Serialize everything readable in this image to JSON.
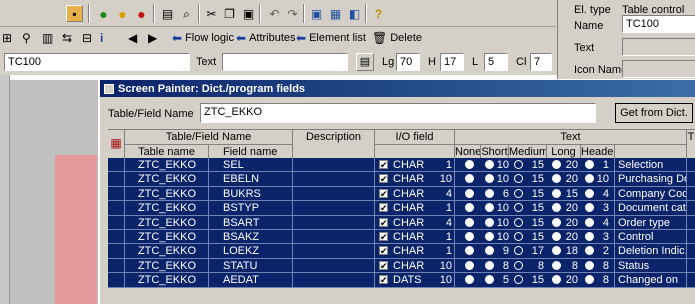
{
  "toolbar1": {
    "icons": [
      "save-icon",
      "back-icon",
      "exit-icon",
      "cancel-icon",
      "print-icon",
      "find-icon",
      "find-next-icon",
      "cut-icon",
      "copy-icon",
      "paste-icon",
      "undo-icon",
      "redo-icon",
      "layout-icon",
      "graphic-icon",
      "window-icon",
      "help-icon"
    ]
  },
  "toolbar2": {
    "flow_logic": "Flow logic",
    "attributes": "Attributes",
    "element_list": "Element list",
    "delete": "Delete"
  },
  "fields": {
    "name_value": "TC100",
    "text_label": "Text",
    "lg_label": "Lg",
    "lg_value": "70",
    "h_label": "H",
    "h_value": "17",
    "l_label": "L",
    "l_value": "5",
    "cl_label": "Cl",
    "cl_value": "7"
  },
  "right_panel": {
    "el_type_label": "El. type",
    "el_type_value": "Table control",
    "name_label": "Name",
    "name_value": "TC100",
    "text_label": "Text",
    "icon_name_label": "Icon Name"
  },
  "dialog": {
    "title": "Screen Painter: Dict./program fields",
    "table_field_label": "Table/Field Name",
    "table_field_value": "ZTC_EKKO",
    "get_from_dict": "Get from Dict.",
    "headers": {
      "table_field_name": "Table/Field Name",
      "table_name": "Table name",
      "field_name": "Field name",
      "description": "Description",
      "io_field": "I/O field",
      "text": "Text",
      "none": "None",
      "short": "Short",
      "medium": "Medium",
      "long": "Long",
      "header": "Header",
      "t": "T"
    },
    "rows": [
      {
        "table": "ZTC_EKKO",
        "field": "SEL",
        "type": "CHAR",
        "len": "1",
        "short": "10",
        "medium": "15",
        "long": "20",
        "header": "1",
        "text": "Selection",
        "sel": "medium"
      },
      {
        "table": "ZTC_EKKO",
        "field": "EBELN",
        "type": "CHAR",
        "len": "10",
        "short": "10",
        "medium": "15",
        "long": "20",
        "header": "10",
        "text": "Purchasing Doc.",
        "sel": "medium"
      },
      {
        "table": "ZTC_EKKO",
        "field": "BUKRS",
        "type": "CHAR",
        "len": "4",
        "short": "6",
        "medium": "15",
        "long": "15",
        "header": "4",
        "text": "Company Code",
        "sel": "medium"
      },
      {
        "table": "ZTC_EKKO",
        "field": "BSTYP",
        "type": "CHAR",
        "len": "1",
        "short": "10",
        "medium": "15",
        "long": "20",
        "header": "3",
        "text": "Document cat.",
        "sel": "medium"
      },
      {
        "table": "ZTC_EKKO",
        "field": "BSART",
        "type": "CHAR",
        "len": "4",
        "short": "10",
        "medium": "15",
        "long": "20",
        "header": "4",
        "text": "Order type",
        "sel": "medium"
      },
      {
        "table": "ZTC_EKKO",
        "field": "BSAKZ",
        "type": "CHAR",
        "len": "1",
        "short": "10",
        "medium": "15",
        "long": "20",
        "header": "3",
        "text": "Control",
        "sel": "medium"
      },
      {
        "table": "ZTC_EKKO",
        "field": "LOEKZ",
        "type": "CHAR",
        "len": "1",
        "short": "9",
        "medium": "17",
        "long": "18",
        "header": "2",
        "text": "Deletion Indic.",
        "sel": "medium"
      },
      {
        "table": "ZTC_EKKO",
        "field": "STATU",
        "type": "CHAR",
        "len": "10",
        "short": "8",
        "medium": "8",
        "long": "8",
        "header": "8",
        "text": "Status",
        "sel": "medium"
      },
      {
        "table": "ZTC_EKKO",
        "field": "AEDAT",
        "type": "DATS",
        "len": "10",
        "short": "5",
        "medium": "15",
        "long": "20",
        "header": "8",
        "text": "Changed on",
        "sel": "medium"
      }
    ]
  }
}
